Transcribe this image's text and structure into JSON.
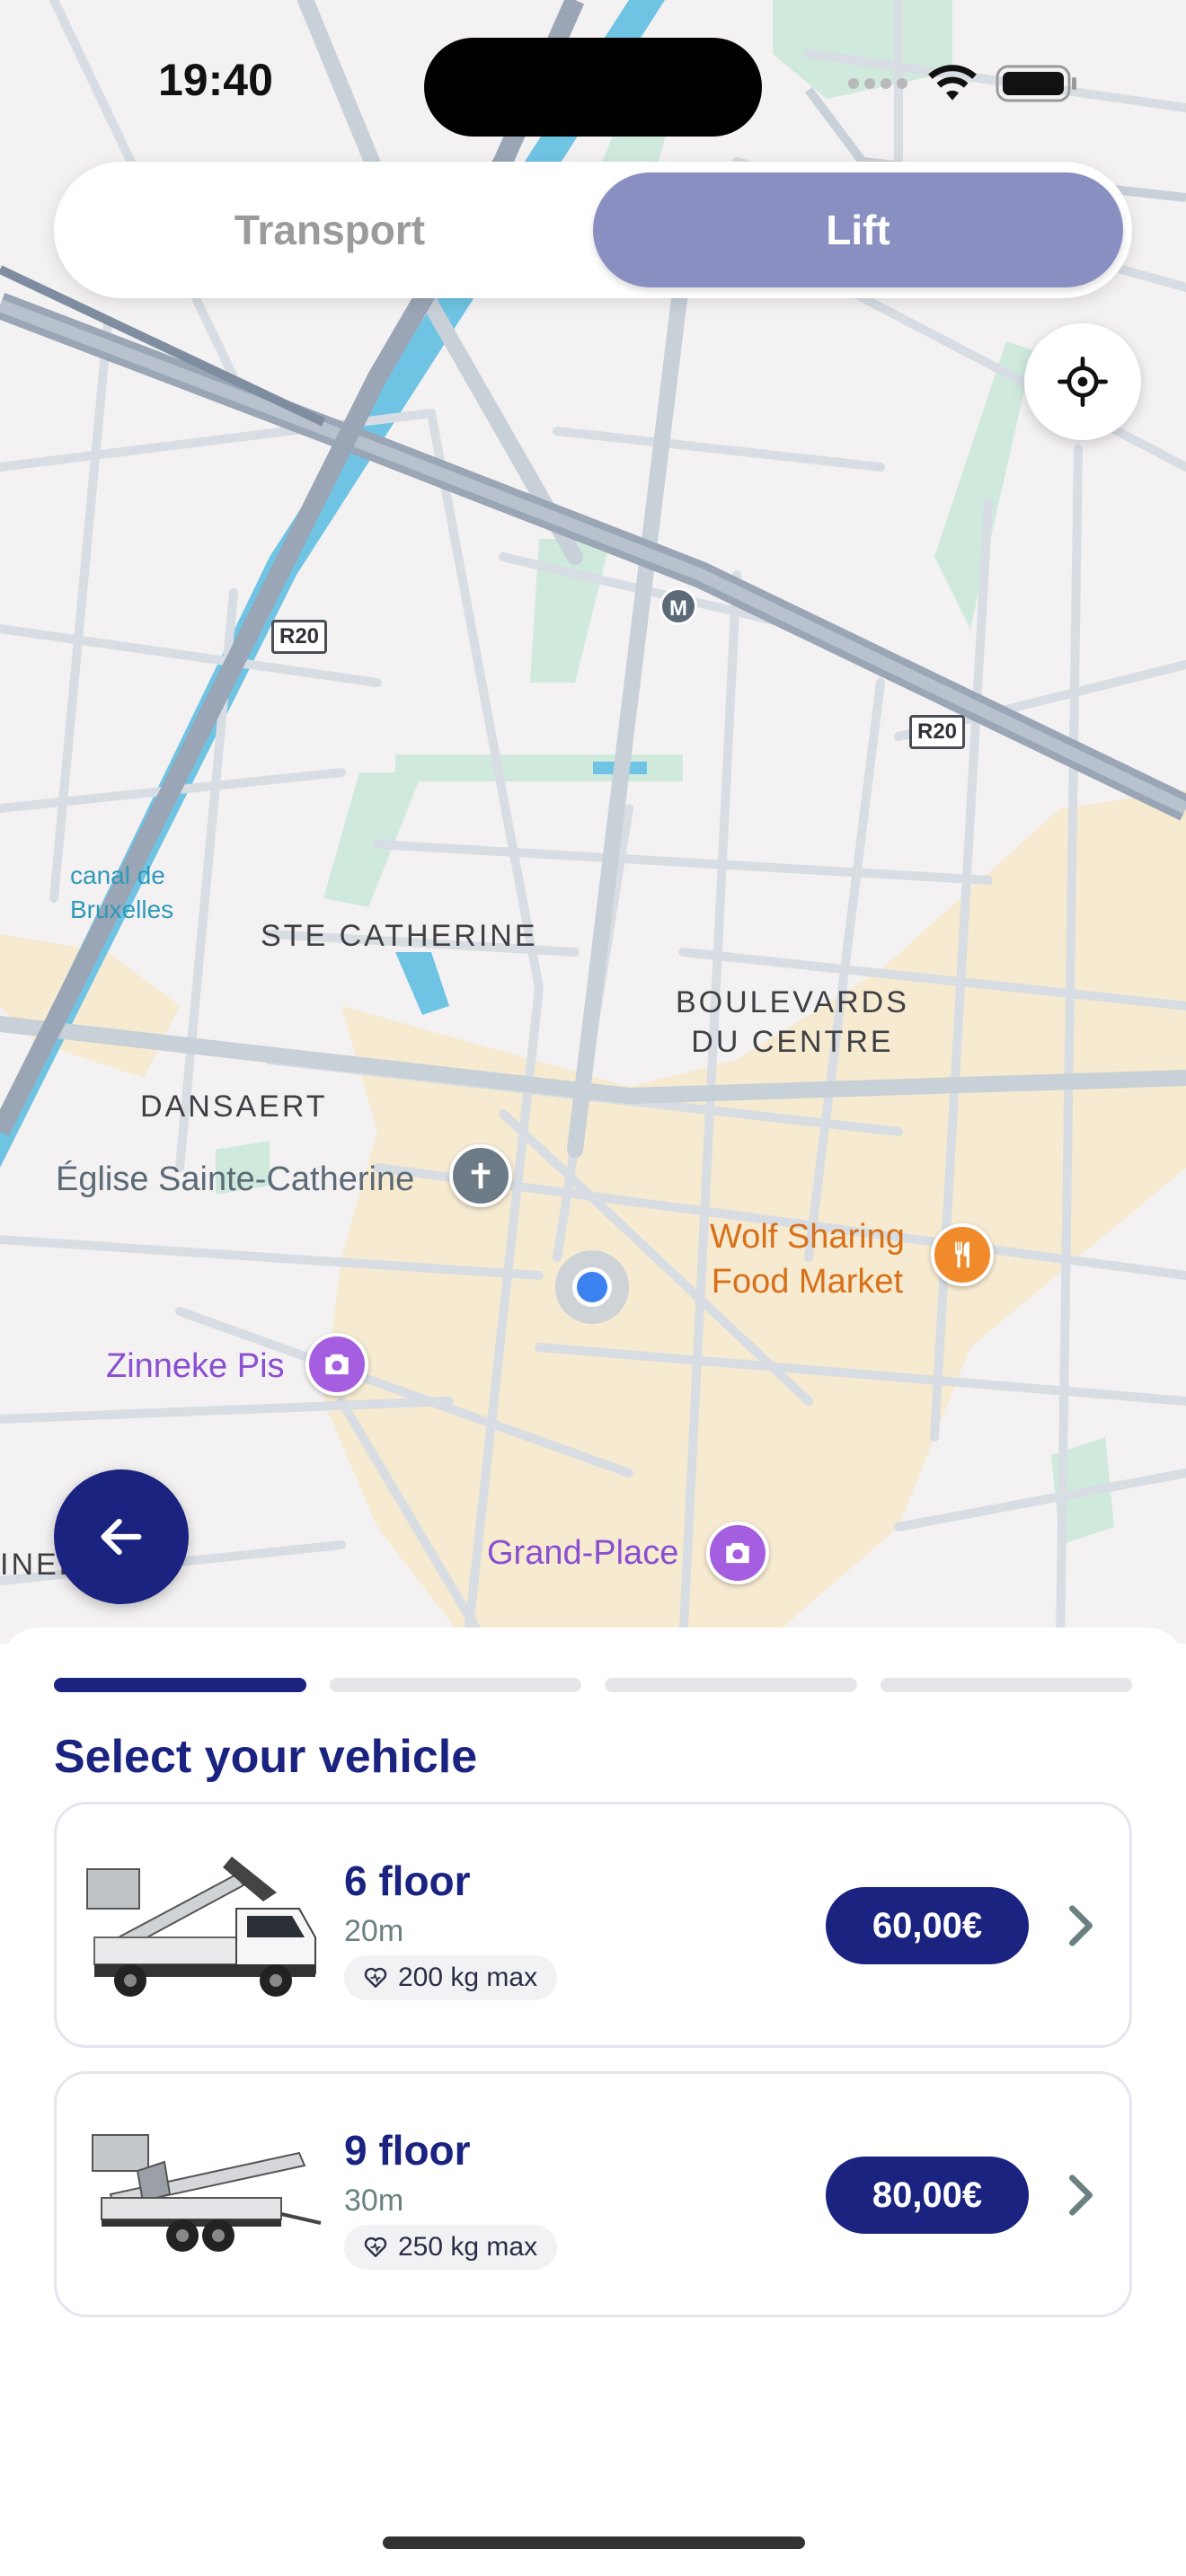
{
  "status_bar": {
    "time": "19:40"
  },
  "mode_switch": {
    "tabs": [
      {
        "label": "Transport",
        "active": false
      },
      {
        "label": "Lift",
        "active": true
      }
    ],
    "active_color": "#8a8fc2"
  },
  "map": {
    "districts": [
      "STE CATHERINE",
      "BOULEVARDS\nDU CENTRE",
      "DANSAERT"
    ],
    "water_label": "canal de\nBruxelles",
    "road_badges": [
      "R20",
      "R20"
    ],
    "metro_badge": "M",
    "pois": {
      "church": "Église Sainte-Catherine",
      "food": "Wolf Sharing\nFood Market",
      "statue": "Zinneke Pis",
      "square": "Grand-Place",
      "partial": "INEL"
    }
  },
  "sheet": {
    "progress_steps": 4,
    "current_step": 1,
    "title": "Select your vehicle",
    "vehicles": [
      {
        "name": "6 floor",
        "height": "20m",
        "capacity": "200 kg max",
        "price": "60,00€"
      },
      {
        "name": "9 floor",
        "height": "30m",
        "capacity": "250 kg max",
        "price": "80,00€"
      }
    ]
  },
  "colors": {
    "brand_navy": "#1b2380",
    "user_location": "#3b82f0",
    "poi_purple": "#8a4fd1",
    "poi_orange": "#d8701a"
  },
  "icons": [
    "signal-icon",
    "wifi-icon",
    "battery-icon",
    "locate-icon",
    "back-arrow-icon",
    "chevron-right-icon",
    "heart-icon"
  ]
}
